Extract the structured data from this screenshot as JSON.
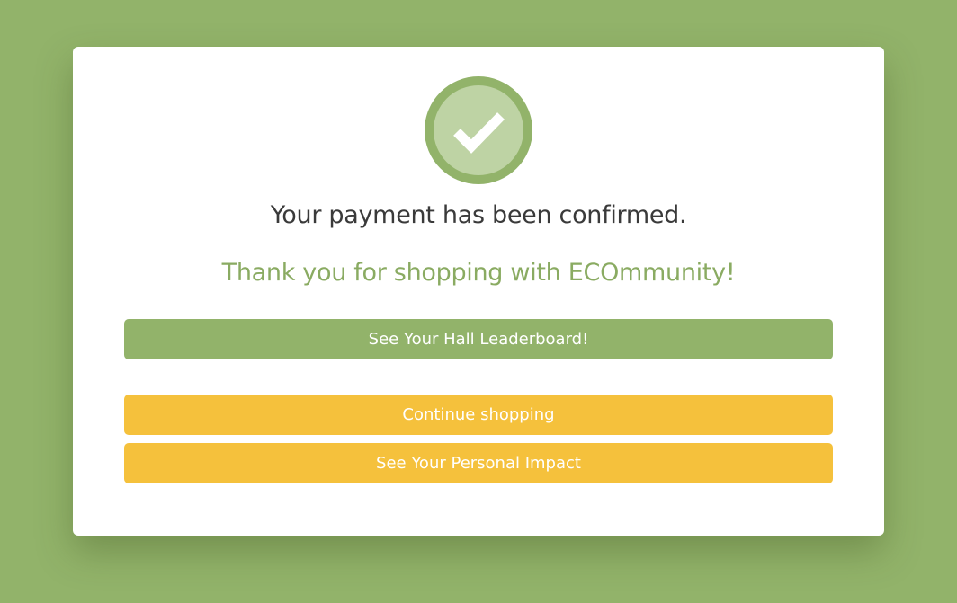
{
  "confirmation": {
    "icon": "check-circle-icon",
    "title": "Your payment has been confirmed.",
    "subtitle": "Thank you for shopping with ECOmmunity!"
  },
  "actions": {
    "leaderboard_label": "See Your Hall Leaderboard!",
    "continue_label": "Continue shopping",
    "impact_label": "See Your Personal Impact"
  },
  "colors": {
    "background": "#92b36a",
    "brand_green": "#92b36a",
    "accent_yellow": "#f5c13c",
    "check_fill": "#bed3a4"
  }
}
